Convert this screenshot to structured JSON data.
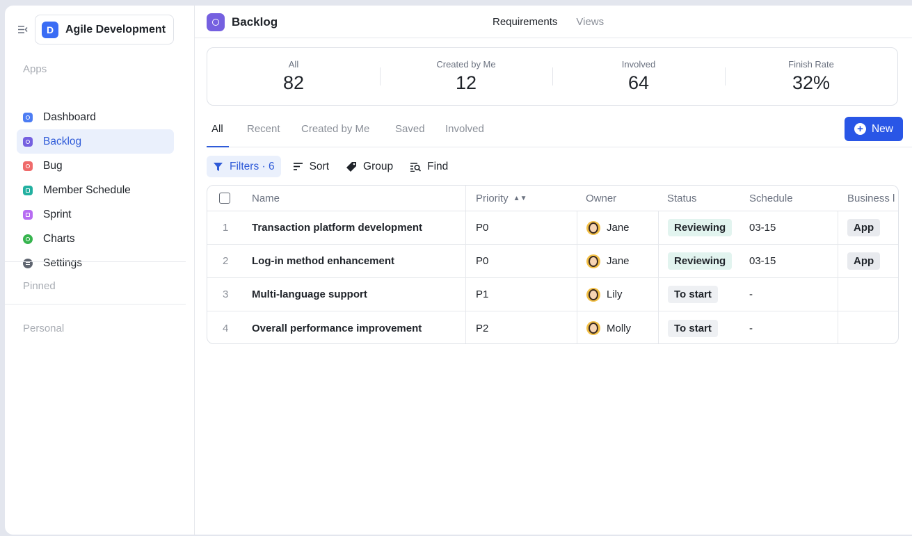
{
  "workspace": {
    "initial": "D",
    "name": "Agile Development"
  },
  "sidebar": {
    "apps_label": "Apps",
    "items": [
      {
        "label": "Dashboard",
        "icon": "dashboard-icon",
        "color": "#4c7cf3"
      },
      {
        "label": "Backlog",
        "icon": "backlog-icon",
        "color": "#7560e0"
      },
      {
        "label": "Bug",
        "icon": "bug-icon",
        "color": "#ef6b6b"
      },
      {
        "label": "Member Schedule",
        "icon": "schedule-icon",
        "color": "#22b0a0"
      },
      {
        "label": "Sprint",
        "icon": "sprint-icon",
        "color": "#b76cf2"
      },
      {
        "label": "Charts",
        "icon": "charts-icon",
        "color": "#36b44e"
      },
      {
        "label": "Settings",
        "icon": "settings-icon",
        "color": "#5f6570"
      }
    ],
    "pinned_label": "Pinned",
    "personal_label": "Personal"
  },
  "header": {
    "title": "Backlog",
    "tabs": [
      "Requirements",
      "Views"
    ]
  },
  "stats": [
    {
      "label": "All",
      "value": "82"
    },
    {
      "label": "Created by Me",
      "value": "12"
    },
    {
      "label": "Involved",
      "value": "64"
    },
    {
      "label": "Finish Rate",
      "value": "32%"
    }
  ],
  "view_tabs": [
    "All",
    "Recent",
    "Created by Me",
    "Saved",
    "Involved"
  ],
  "new_button": "New",
  "toolbar": {
    "filters": "Filters · 6",
    "sort": "Sort",
    "group": "Group",
    "find": "Find"
  },
  "table": {
    "columns": [
      "Name",
      "Priority",
      "Owner",
      "Status",
      "Schedule",
      "Business l"
    ],
    "rows": [
      {
        "index": "1",
        "name": "Transaction platform development",
        "priority": "P0",
        "owner": "Jane",
        "status": "Reviewing",
        "schedule": "03-15",
        "business": "App"
      },
      {
        "index": "2",
        "name": "Log-in method enhancement",
        "priority": "P0",
        "owner": "Jane",
        "status": "Reviewing",
        "schedule": "03-15",
        "business": "App"
      },
      {
        "index": "3",
        "name": "Multi-language support",
        "priority": "P1",
        "owner": "Lily",
        "status": "To start",
        "schedule": "-",
        "business": ""
      },
      {
        "index": "4",
        "name": "Overall performance improvement",
        "priority": "P2",
        "owner": "Molly",
        "status": "To start",
        "schedule": "-",
        "business": ""
      }
    ]
  }
}
